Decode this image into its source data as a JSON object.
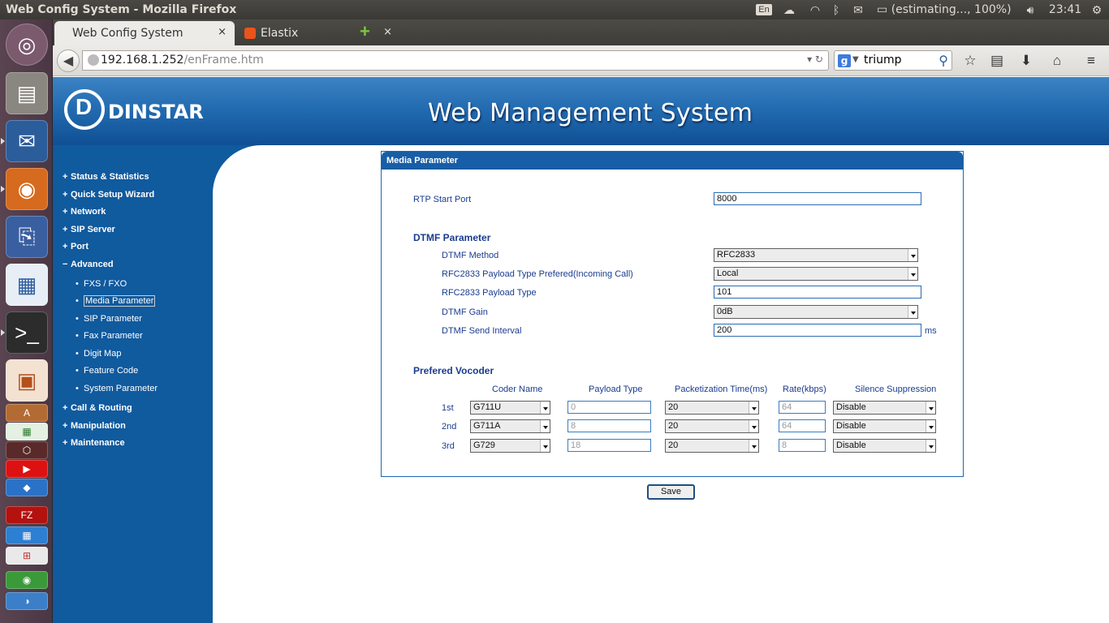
{
  "window": {
    "title": "Web Config System - Mozilla Firefox"
  },
  "tray": {
    "keyboard": "En",
    "battery": "(estimating..., 100%)",
    "clock": "23:41"
  },
  "browser": {
    "tabs": [
      {
        "label": "Web Config System",
        "close": "×"
      },
      {
        "label": "Elastix",
        "close": "×"
      }
    ],
    "new_tab": "+",
    "url_host": "192.168.1.252",
    "url_path": "/enFrame.htm",
    "search_value": "triump"
  },
  "header": {
    "logo_text": "DINSTAR",
    "title": "Web Management System"
  },
  "sidebar": {
    "items": [
      {
        "label": "Status & Statistics",
        "bullet": "+"
      },
      {
        "label": "Quick Setup Wizard",
        "bullet": "+"
      },
      {
        "label": "Network",
        "bullet": "+"
      },
      {
        "label": "SIP Server",
        "bullet": "+"
      },
      {
        "label": "Port",
        "bullet": "+"
      },
      {
        "label": "Advanced",
        "bullet": "−"
      },
      {
        "label": "Call & Routing",
        "bullet": "+"
      },
      {
        "label": "Manipulation",
        "bullet": "+"
      },
      {
        "label": "Maintenance",
        "bullet": "+"
      }
    ],
    "sub_items": [
      {
        "label": "FXS / FXO"
      },
      {
        "label": "Media Parameter"
      },
      {
        "label": "SIP Parameter"
      },
      {
        "label": "Fax Parameter"
      },
      {
        "label": "Digit Map"
      },
      {
        "label": "Feature Code"
      },
      {
        "label": "System Parameter"
      }
    ]
  },
  "panel": {
    "title": "Media Parameter",
    "rtp_label": "RTP Start Port",
    "rtp_value": "8000",
    "dtmf": {
      "title": "DTMF Parameter",
      "method_label": "DTMF Method",
      "method_value": "RFC2833",
      "payload_pref_label": "RFC2833 Payload Type Prefered(Incoming Call)",
      "payload_pref_value": "Local",
      "payload_label": "RFC2833 Payload Type",
      "payload_value": "101",
      "gain_label": "DTMF Gain",
      "gain_value": "0dB",
      "interval_label": "DTMF Send Interval",
      "interval_value": "200",
      "interval_unit": "ms"
    },
    "vocoder": {
      "title": "Prefered Vocoder",
      "headers": [
        "Coder Name",
        "Payload Type",
        "Packetization Time(ms)",
        "Rate(kbps)",
        "Silence Suppression"
      ],
      "rows": [
        {
          "order": "1st",
          "coder": "G711U",
          "payload": "0",
          "ptime": "20",
          "rate": "64",
          "silence": "Disable"
        },
        {
          "order": "2nd",
          "coder": "G711A",
          "payload": "8",
          "ptime": "20",
          "rate": "64",
          "silence": "Disable"
        },
        {
          "order": "3rd",
          "coder": "G729",
          "payload": "18",
          "ptime": "20",
          "rate": "8",
          "silence": "Disable"
        }
      ]
    },
    "save_label": "Save"
  }
}
